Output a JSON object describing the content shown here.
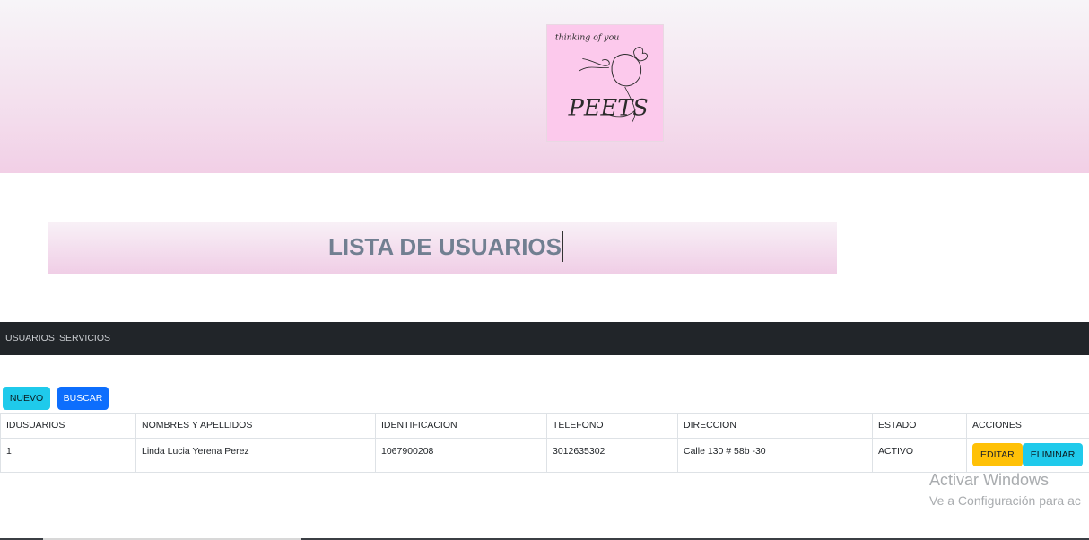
{
  "header": {
    "logo_text_top": "thinking of you",
    "logo_text_bottom": "PEETS"
  },
  "page_title": "LISTA DE USUARIOS",
  "navbar": {
    "items": [
      {
        "label": "USUARIOS"
      },
      {
        "label": "SERVICIOS"
      }
    ]
  },
  "toolbar": {
    "new_label": "NUEVO",
    "search_label": "BUSCAR"
  },
  "table": {
    "columns": [
      "IDUSUARIOS",
      "NOMBRES Y APELLIDOS",
      "IDENTIFICACION",
      "TELEFONO",
      "DIRECCION",
      "ESTADO",
      "ACCIONES"
    ],
    "rows": [
      {
        "id": "1",
        "name": "Linda Lucia Yerena Perez",
        "identification": "1067900208",
        "phone": "3012635302",
        "address": "Calle 130 # 58b -30",
        "status": "ACTIVO",
        "edit_label": "EDITAR",
        "delete_label": "ELIMINAR"
      }
    ]
  },
  "watermark": {
    "line1": "Activar Windows",
    "line2": "Ve a Configuración para ac"
  },
  "colors": {
    "hero_pink": "#f2cfe6",
    "logo_bg": "#fcc9ec",
    "navbar_bg": "#212529",
    "info_button": "#1fcaeb",
    "primary_button": "#0d6efd",
    "warning_button": "#ffc107",
    "title_text": "#717f91"
  }
}
